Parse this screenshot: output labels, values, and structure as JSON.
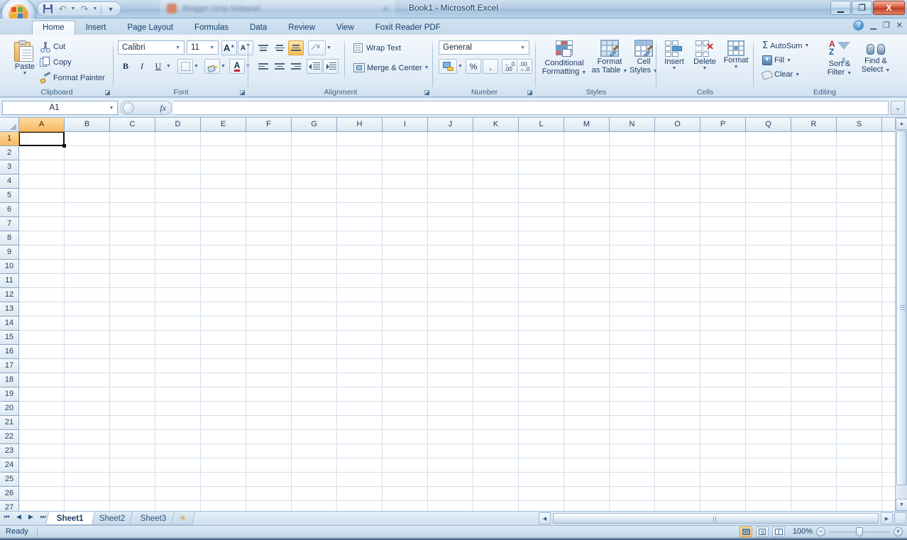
{
  "window": {
    "title": "Book1 - Microsoft Excel",
    "background_window_title": "Blogger Drop Notepad",
    "controls": {
      "minimize": "—",
      "restore": "❐",
      "close": "X"
    }
  },
  "quick_access": {
    "office_button": "office-button",
    "items": [
      {
        "name": "save",
        "label": "Save"
      },
      {
        "name": "undo",
        "label": "Undo"
      },
      {
        "name": "redo",
        "label": "Redo"
      },
      {
        "name": "customize",
        "label": "Customize Quick Access Toolbar"
      }
    ]
  },
  "ribbon": {
    "tabs": [
      {
        "label": "Home",
        "active": true
      },
      {
        "label": "Insert",
        "active": false
      },
      {
        "label": "Page Layout",
        "active": false
      },
      {
        "label": "Formulas",
        "active": false
      },
      {
        "label": "Data",
        "active": false
      },
      {
        "label": "Review",
        "active": false
      },
      {
        "label": "View",
        "active": false
      },
      {
        "label": "Foxit Reader PDF",
        "active": false
      }
    ],
    "window_controls": {
      "help": "?",
      "minimize": "—",
      "restore": "❐",
      "close": "✕"
    },
    "groups": {
      "clipboard": {
        "label": "Clipboard",
        "paste": "Paste",
        "cut": "Cut",
        "copy": "Copy",
        "format_painter": "Format Painter"
      },
      "font": {
        "label": "Font",
        "font_name": "Calibri",
        "font_size": "11",
        "grow_font": "A",
        "shrink_font": "A",
        "bold": "B",
        "italic": "I",
        "underline": "U"
      },
      "alignment": {
        "label": "Alignment",
        "wrap_text": "Wrap Text",
        "merge_center": "Merge & Center"
      },
      "number": {
        "label": "Number",
        "format": "General",
        "percent": "%",
        "comma": ",",
        "increase_decimal": ".00",
        "decrease_decimal": ".00"
      },
      "styles": {
        "label": "Styles",
        "conditional_formatting": "Conditional\nFormatting",
        "conditional_formatting_l1": "Conditional",
        "conditional_formatting_l2": "Formatting",
        "format_as_table_l1": "Format",
        "format_as_table_l2": "as Table",
        "cell_styles_l1": "Cell",
        "cell_styles_l2": "Styles"
      },
      "cells": {
        "label": "Cells",
        "insert": "Insert",
        "delete": "Delete",
        "format": "Format"
      },
      "editing": {
        "label": "Editing",
        "autosum": "AutoSum",
        "fill": "Fill",
        "clear": "Clear",
        "sort_filter_l1": "Sort &",
        "sort_filter_l2": "Filter",
        "find_select_l1": "Find &",
        "find_select_l2": "Select"
      }
    }
  },
  "formula_bar": {
    "name_box_value": "A1",
    "name_box_placeholder": "Name Box",
    "fx_label": "fx",
    "formula_value": "",
    "formula_placeholder": "",
    "expand_icon": "⌄⌄"
  },
  "grid": {
    "columns": [
      "A",
      "B",
      "C",
      "D",
      "E",
      "F",
      "G",
      "H",
      "I",
      "J",
      "K",
      "L",
      "M",
      "N",
      "O",
      "P",
      "Q",
      "R",
      "S"
    ],
    "rows": [
      1,
      2,
      3,
      4,
      5,
      6,
      7,
      8,
      9,
      10,
      11,
      12,
      13,
      14,
      15,
      16,
      17,
      18,
      19,
      20,
      21,
      22,
      23,
      24,
      25,
      26,
      27
    ],
    "selected_cell": "A1",
    "selected_column": "A",
    "selected_row": 1,
    "cell_values": {}
  },
  "sheet_tabs": {
    "nav": [
      "⏮",
      "◀",
      "▶",
      "⏭"
    ],
    "tabs": [
      {
        "label": "Sheet1",
        "active": true
      },
      {
        "label": "Sheet2",
        "active": false
      },
      {
        "label": "Sheet3",
        "active": false
      }
    ],
    "insert_sheet": "✳"
  },
  "status_bar": {
    "status": "Ready",
    "views": [
      {
        "name": "normal",
        "active": true
      },
      {
        "name": "page-layout",
        "active": false
      },
      {
        "name": "page-break-preview",
        "active": false
      }
    ],
    "zoom": "100%",
    "zoom_out": "−",
    "zoom_in": "+"
  },
  "colors": {
    "accent": "#1b3b5e",
    "selection_header": "#f6ba62",
    "close_button": "#d9543a",
    "grid_line": "#d3dfeb",
    "ribbon_bg": "#e6eff8"
  }
}
